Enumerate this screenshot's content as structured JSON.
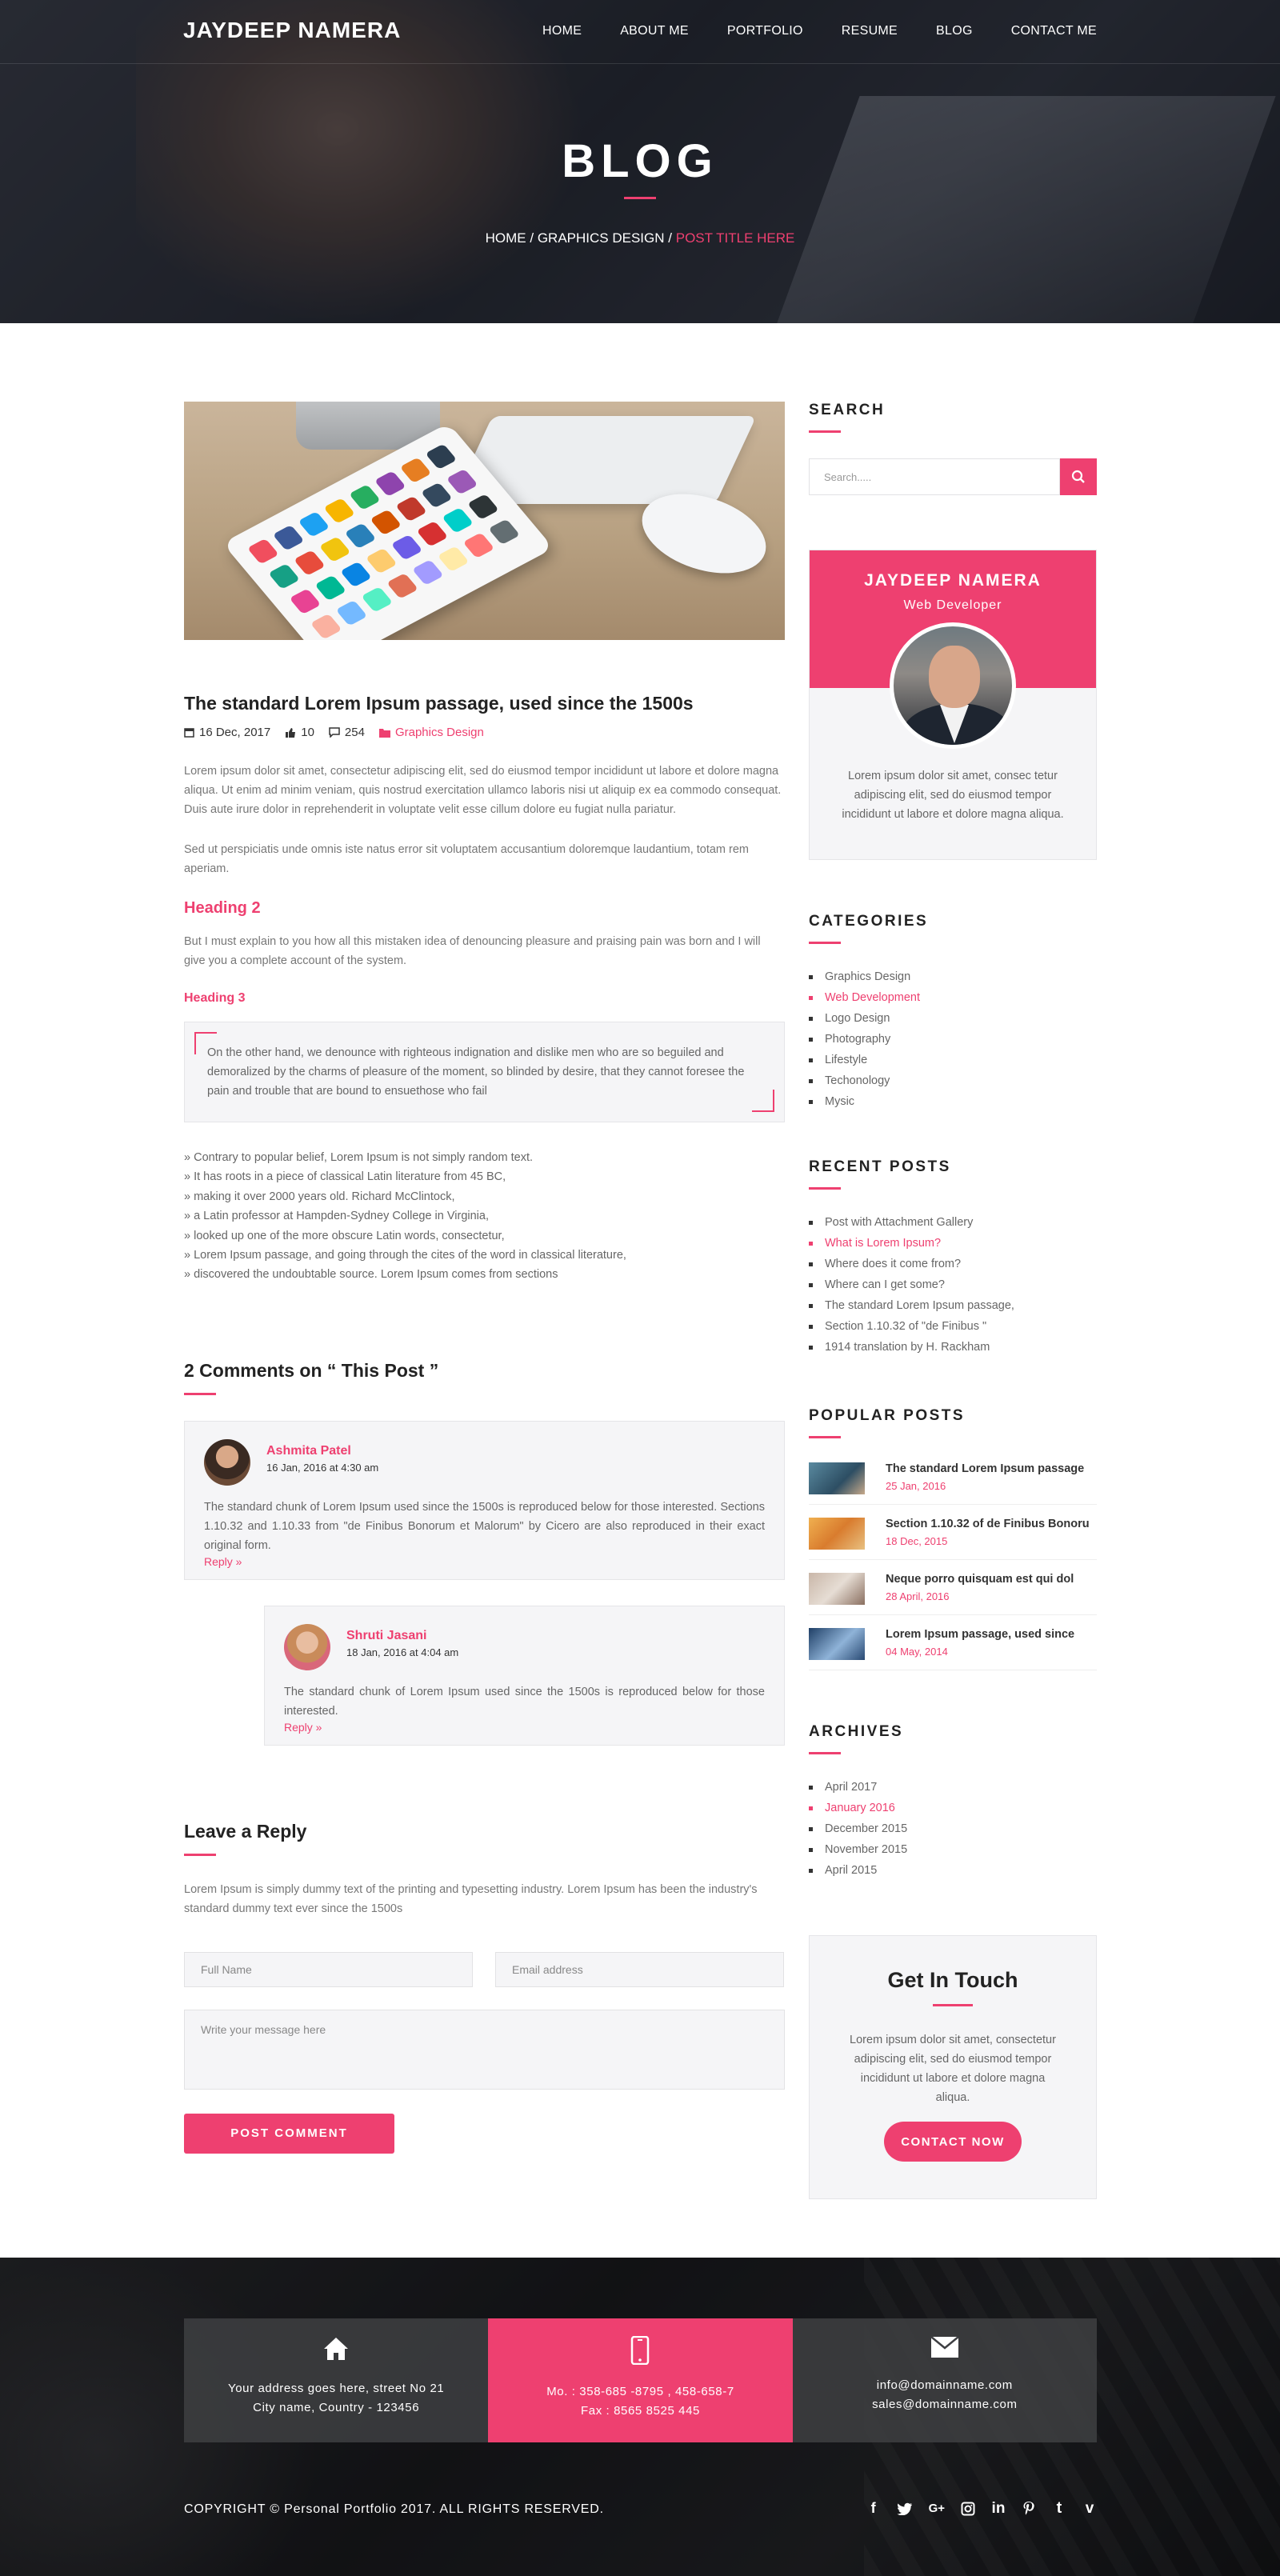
{
  "site": {
    "logo": "JAYDEEP NAMERA",
    "nav": [
      "HOME",
      "ABOUT ME",
      "PORTFOLIO",
      "RESUME",
      "BLOG",
      "CONTACT ME"
    ]
  },
  "hero": {
    "title": "BLOG",
    "breadcrumb": {
      "home": "HOME",
      "sep": "/",
      "category": "GRAPHICS DESIGN",
      "current": "POST TITLE HERE"
    }
  },
  "post": {
    "title": "The standard Lorem Ipsum passage, used since the 1500s",
    "date": "16 Dec, 2017",
    "likes": "10",
    "comments": "254",
    "category": "Graphics Design",
    "para1": "Lorem ipsum dolor sit amet, consectetur adipiscing elit, sed do eiusmod tempor incididunt ut labore et dolore magna aliqua. Ut enim ad minim veniam, quis nostrud exercitation ullamco laboris nisi ut aliquip ex ea commodo consequat. Duis aute irure dolor in reprehenderit in voluptate velit esse cillum dolore eu fugiat nulla pariatur.",
    "para2": "Sed ut perspiciatis unde omnis iste natus error sit voluptatem accusantium doloremque laudantium, totam rem aperiam.",
    "heading2": "Heading 2",
    "para3": "But I must explain to you how all this mistaken idea of denouncing pleasure and praising pain was born and I will give you a complete account of the system.",
    "heading3": "Heading 3",
    "quote": "On the other hand, we denounce with righteous indignation and dislike men who are so beguiled and demoralized by the charms of pleasure of the moment, so blinded by desire, that they cannot foresee the pain and trouble that are bound to ensuethose who fail",
    "list": [
      "» Contrary to popular belief, Lorem Ipsum is not simply random text.",
      "» It has roots in a piece of classical Latin literature from 45 BC,",
      "» making it over 2000 years old. Richard McClintock,",
      "» a Latin professor at Hampden-Sydney College in Virginia,",
      "» looked up one of the more obscure Latin words, consectetur,",
      "» Lorem Ipsum passage, and going through the cites of the word in classical literature,",
      "» discovered the undoubtable source. Lorem Ipsum comes from sections"
    ]
  },
  "comments": {
    "heading": "2 Comments on “ This Post ”",
    "items": [
      {
        "name": "Ashmita Patel",
        "date": "16 Jan, 2016 at 4:30 am",
        "text": "The standard chunk of Lorem Ipsum used since the 1500s is reproduced below for those interested. Sections 1.10.32 and 1.10.33 from \"de Finibus Bonorum et Malorum\" by Cicero are also reproduced in their exact original form.",
        "reply": "Reply »"
      },
      {
        "name": "Shruti Jasani",
        "date": "18 Jan, 2016 at 4:04 am",
        "text": "The standard chunk of Lorem Ipsum used since the 1500s is reproduced below for those interested.",
        "reply": "Reply »"
      }
    ]
  },
  "reply_form": {
    "heading": "Leave a Reply",
    "intro": "Lorem Ipsum is simply dummy text of the printing and typesetting industry. Lorem Ipsum has been the industry's standard dummy text ever since the 1500s",
    "name_placeholder": "Full Name",
    "email_placeholder": "Email address",
    "message_placeholder": "Write your message here",
    "submit": "POST COMMENT"
  },
  "sidebar": {
    "search": {
      "title": "SEARCH",
      "placeholder": "Search....."
    },
    "profile": {
      "name": "JAYDEEP NAMERA",
      "role": "Web Developer",
      "text": "Lorem ipsum dolor sit amet, consec tetur adipiscing elit, sed do eiusmod tempor incididunt ut labore et dolore magna aliqua."
    },
    "categories": {
      "title": "CATEGORIES",
      "items": [
        "Graphics Design",
        "Web Development",
        "Logo Design",
        "Photography",
        "Lifestyle",
        "Techonology",
        "Mysic"
      ],
      "active_index": 1
    },
    "recent": {
      "title": "RECENT POSTS",
      "items": [
        "Post with Attachment Gallery",
        "What is Lorem Ipsum?",
        "Where does it come from?",
        "Where can I get some?",
        "The standard Lorem Ipsum passage,",
        "Section 1.10.32 of \"de Finibus \"",
        "1914 translation by H. Rackham"
      ],
      "active_index": 1
    },
    "popular": {
      "title": "POPULAR POSTS",
      "items": [
        {
          "title": "The standard Lorem Ipsum passage",
          "date": "25 Jan, 2016"
        },
        {
          "title": "Section 1.10.32 of de Finibus Bonoru",
          "date": "18 Dec, 2015"
        },
        {
          "title": "Neque porro quisquam est qui dol",
          "date": "28 April, 2016"
        },
        {
          "title": "Lorem Ipsum passage, used since",
          "date": "04 May, 2014"
        }
      ]
    },
    "archives": {
      "title": "ARCHIVES",
      "items": [
        "April 2017",
        "January 2016",
        "December 2015",
        "November 2015",
        "April 2015"
      ],
      "active_index": 1
    },
    "touch": {
      "title": "Get In Touch",
      "text": "Lorem ipsum dolor sit amet, consectetur adipiscing elit, sed do eiusmod tempor incididunt ut labore et dolore magna aliqua.",
      "button": "CONTACT NOW"
    }
  },
  "footer": {
    "address": [
      "Your address goes here, street No 21",
      "City name, Country - 123456"
    ],
    "phone": [
      "Mo. : 358-685 -8795 , 458-658-7",
      "Fax : 8565 8525 445"
    ],
    "email": [
      "info@domainname.com",
      "sales@domainname.com"
    ],
    "copyright": "COPYRIGHT © Personal Portfolio 2017. ALL RIGHTS RESERVED.",
    "social": [
      "facebook-icon",
      "twitter-icon",
      "google-plus-icon",
      "instagram-icon",
      "linkedin-icon",
      "pinterest-icon",
      "tumblr-icon",
      "vimeo-icon"
    ]
  },
  "colors": {
    "accent": "#ee4070",
    "dark": "#222222",
    "panel": "#f5f5f7"
  }
}
